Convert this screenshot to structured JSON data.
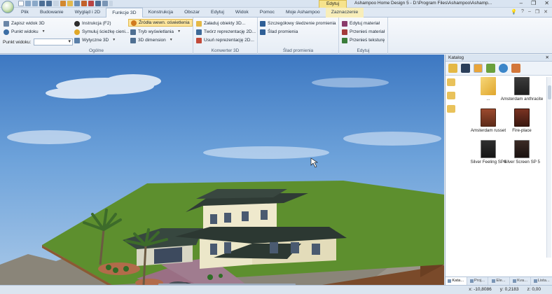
{
  "titlebar": {
    "context_tab": "Edytuj",
    "window_title": "Ashampoo Home Design 5 - D:\\Program Files\\Ashampoo\\Ashamp...",
    "buttons": [
      "–",
      "❐",
      "✕"
    ]
  },
  "tabs": [
    {
      "label": "Plik"
    },
    {
      "label": "Budowanie"
    },
    {
      "label": "Wygląd i 2D"
    },
    {
      "label": "Funkcje 3D"
    },
    {
      "label": "Konstrukcja"
    },
    {
      "label": "Obszar"
    },
    {
      "label": "Edytuj"
    },
    {
      "label": "Widok"
    },
    {
      "label": "Pomoc"
    },
    {
      "label": "Moje Ashampoo"
    },
    {
      "label": "Zaznaczenie"
    }
  ],
  "active_tab": "Funkcje 3D",
  "ribbon": {
    "general": {
      "label": "Ogólne",
      "save_view": "Zapisz widok 3D",
      "viewpoint": "Punkt widoku",
      "viewpoint_combo_label": "Punkt widoku:",
      "instruction": "Instrukcja (F2)",
      "simulate_path": "Symuluj ścieżkę cieni...",
      "guides_3d": "Wytyczne 3D",
      "light_sources": "Źródła wewn. oświetlenia",
      "display_mode": "Tryb wyświetlania",
      "dimension_3d": "3D dimension"
    },
    "converter": {
      "label": "Konwerter 3D",
      "load_objects": "Załaduj obiekty 3D...",
      "create_2d": "Twórz reprezentację 2D...",
      "remove_2d": "Usuń reprezentację 2D..."
    },
    "ray": {
      "label": "Ślad promienia",
      "detailed_tracing": "Szczegółowy śledzenie promienia",
      "ray_trace": "Ślad promienia"
    },
    "edit": {
      "label": "Edytuj",
      "edit_material": "Edytuj materiał",
      "transfer_material": "Przenieś materiał",
      "transfer_texture": "Przenieś teksturę"
    }
  },
  "catalog": {
    "title": "Katalog",
    "items": [
      {
        "name": "..."
      },
      {
        "name": "Amsterdam anthracite"
      },
      {
        "name": "Amsterdam russet"
      },
      {
        "name": "Fire-place"
      },
      {
        "name": "Silver Feeling SP4"
      },
      {
        "name": "Silver Screen SP 5"
      }
    ],
    "bottom_tabs": [
      "Kata...",
      "Proj...",
      "Ele...",
      "Kva...",
      "Lista..."
    ]
  },
  "status": {
    "x": "x: -10,8086",
    "y": "y: 0,2183",
    "z": "z: 0,00"
  },
  "colors": {
    "ribbon_bg": "#eef3f9",
    "highlight": "#fde59b",
    "sky": "#5f96d2",
    "grass": "#5d8f2e"
  }
}
